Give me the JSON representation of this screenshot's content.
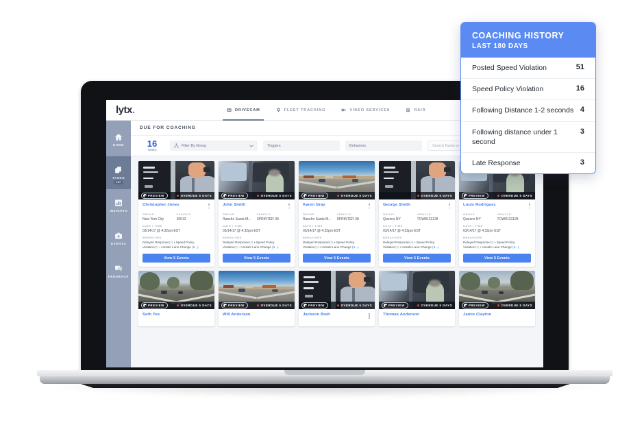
{
  "app": {
    "logo": "lytx",
    "nav": [
      {
        "label": "DRIVECAM",
        "icon": "drivecam-icon",
        "active": true
      },
      {
        "label": "FLEET TRACKING",
        "icon": "fleet-tracking-icon",
        "active": false
      },
      {
        "label": "VIDEO SERVICES",
        "icon": "video-services-icon",
        "active": false
      },
      {
        "label": "RAIR",
        "icon": "rair-icon",
        "active": false
      }
    ]
  },
  "sidebar": {
    "items": [
      {
        "label": "HOME",
        "icon": "home-icon",
        "active": false,
        "badge": ""
      },
      {
        "label": "TASKS",
        "icon": "tasks-icon",
        "active": true,
        "badge": "237"
      },
      {
        "label": "INSIGHTS",
        "icon": "insights-icon",
        "active": false,
        "badge": ""
      },
      {
        "label": "EVENTS",
        "icon": "events-icon",
        "active": false,
        "badge": ""
      },
      {
        "label": "FEEDBACK",
        "icon": "feedback-icon",
        "active": false,
        "badge": ""
      }
    ]
  },
  "page": {
    "title": "DUE FOR COACHING"
  },
  "toolbar": {
    "tasks_count": "16",
    "tasks_label": "Tasks",
    "filter_group": "Filter By Group",
    "triggers": "Triggers",
    "behaviors": "Behaviors",
    "search_placeholder": "Search Name or ID"
  },
  "card_labels": {
    "group": "GROUP",
    "vehicle": "VEHICLE",
    "datetime": "DATE / TIME",
    "behaviors": "BEHAVIORS",
    "preview": "PREVIEW",
    "overdue": "OVERDUE 5 DAYS",
    "cta": "View 5 Events"
  },
  "cards": [
    {
      "name": "Christopher Jones",
      "group": "New York City",
      "vehicle": "39013",
      "datetime": "03/14/17 @ 4:32pm EST",
      "behaviors": "Delayed Response(2) • Speed Policy Violation(2) • Unsafe Lane Change (6...)",
      "scene": "cab-driver"
    },
    {
      "name": "John Smith",
      "group": "Rancho Santa M...",
      "vehicle": "SPRINTER 38",
      "datetime": "03/14/17 @ 4:32pm EST",
      "behaviors": "Delayed Response(2) • Speed Policy Violation(2) • Unsafe Lane Change (6...)",
      "scene": "cab-window"
    },
    {
      "name": "Karen Gray",
      "group": "Rancho Santa M...",
      "vehicle": "SPRINTER 38",
      "datetime": "03/14/17 @ 4:32pm EST",
      "behaviors": "Delayed Response(2) • Speed Policy Violation(2) • Unsafe Lane Change (6...)",
      "scene": "road"
    },
    {
      "name": "George Smith",
      "group": "Queens NY",
      "vehicle": "TOW8123128",
      "datetime": "03/14/17 @ 4:32pm EST",
      "behaviors": "Delayed Response(2) • Speed Policy Violation(2) • Unsafe Lane Change (6...)",
      "scene": "cab-driver"
    },
    {
      "name": "Louis Rodriguez",
      "group": "Queens NY",
      "vehicle": "TOW8123128",
      "datetime": "03/14/17 @ 4:32pm EST",
      "behaviors": "Delayed Response(2) • Speed Policy Violation(2) • Unsafe Lane Change (6...)",
      "scene": "cab-window"
    }
  ],
  "cards_row2": [
    {
      "name": "Seth Yee",
      "scene": "road-trees"
    },
    {
      "name": "Will Anderson",
      "scene": "road-lot"
    },
    {
      "name": "Jackson Brah",
      "scene": "cab-driver"
    },
    {
      "name": "Thomas Anderson",
      "scene": "cab-window"
    },
    {
      "name": "Jamie Clayton",
      "scene": "road-trees"
    }
  ],
  "coaching": {
    "title": "COACHING HISTORY",
    "subtitle": "LAST 180 DAYS",
    "rows": [
      {
        "label": "Posted Speed Violation",
        "value": "51"
      },
      {
        "label": "Speed Policy Violation",
        "value": "16"
      },
      {
        "label": "Following Distance 1-2 seconds",
        "value": "4"
      },
      {
        "label": "Following distance under 1 second",
        "value": "3"
      },
      {
        "label": "Late Response",
        "value": "3"
      }
    ]
  },
  "colors": {
    "accent_blue": "#4a82f0",
    "panel_blue": "#5b8bf2",
    "sidebar": "#93a0b8",
    "overdue_red": "#e8453c"
  }
}
